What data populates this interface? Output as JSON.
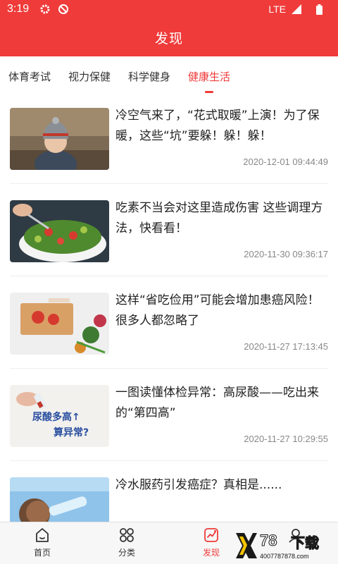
{
  "status_bar": {
    "time": "3:19",
    "network": "LTE",
    "icons": [
      "gear-icon",
      "sync-icon",
      "signal-icon",
      "battery-icon"
    ]
  },
  "header": {
    "title": "发现"
  },
  "tabs": [
    {
      "label": "体育考试",
      "active": false
    },
    {
      "label": "视力保健",
      "active": false
    },
    {
      "label": "科学健身",
      "active": false
    },
    {
      "label": "健康生活",
      "active": true
    }
  ],
  "news": [
    {
      "title": "冷空气来了，“花式取暖”上演！为了保暖，这些“坑”要躲！躲！躲！",
      "date": "2020-12-01 09:44:49",
      "thumb": "child-in-winter-hat"
    },
    {
      "title": "吃素不当会对这里造成伤害 这些调理方法，快看看！",
      "date": "2020-11-30 09:36:17",
      "thumb": "vegetable-salad-bowl"
    },
    {
      "title": "这样“省吃俭用”可能会增加患癌风险！很多人都忽略了",
      "date": "2020-11-27 17:13:45",
      "thumb": "cutting-tomatoes"
    },
    {
      "title": "一图读懂体检异常：高尿酸——吃出来的“第四高”",
      "date": "2020-11-27 10:29:55",
      "thumb": "uric-acid-infographic",
      "thumb_text": [
        "尿酸多高↑",
        "算异常?"
      ]
    },
    {
      "title": "冷水服药引发癌症？真相是......",
      "date": "",
      "thumb": "drinking-water"
    }
  ],
  "bottom_nav": [
    {
      "label": "首页",
      "icon": "home-icon",
      "active": false
    },
    {
      "label": "分类",
      "icon": "grid-icon",
      "active": false
    },
    {
      "label": "发现",
      "icon": "discover-icon",
      "active": true
    },
    {
      "label": "",
      "icon": "user-icon",
      "active": false
    }
  ],
  "watermark": {
    "brand": "78",
    "brand_cn": "下载",
    "url": "4007787878.com"
  },
  "colors": {
    "accent": "#ef3b3a",
    "date": "#888888",
    "divider": "#eeeeee"
  }
}
